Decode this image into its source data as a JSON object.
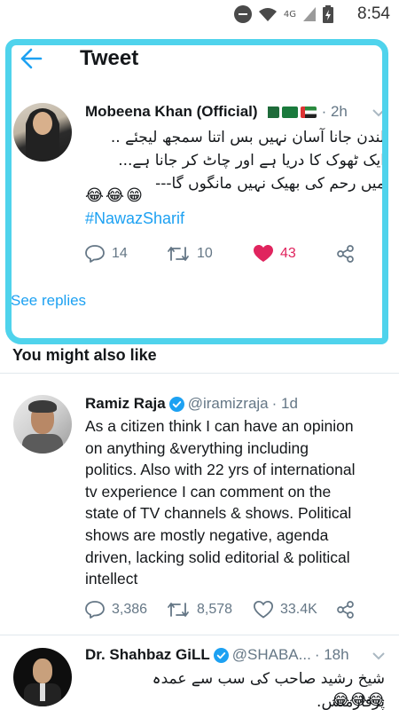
{
  "status_bar": {
    "network_label": "4G",
    "time": "8:54"
  },
  "header": {
    "title": "Tweet"
  },
  "main_tweet": {
    "name": "Mobeena Khan (Official)",
    "time": "· 2h",
    "lines": [
      "لندن جانا آسان نہیں بس اتنا سمجھ لیجئے ..",
      "ایک ٹھوک کا دریا ہے اور چاٹ کر جانا ہے...",
      "میں رحم کی بھیک نہیں مانگوں گا---"
    ],
    "emojis": "😂😂😁",
    "hashtag": "#NawazSharif",
    "replies": "14",
    "retweets": "10",
    "likes": "43"
  },
  "see_replies": "See replies",
  "section_title": "You might also like",
  "tweets": [
    {
      "name": "Ramiz Raja",
      "handle": "@iramizraja",
      "time": "· 1d",
      "lines": [
        "As a citizen think I can have an opinion",
        "on anything &verything including",
        "politics. Also with 22 yrs of international",
        "tv experience I can comment on the",
        "state of TV channels & shows. Political",
        "shows are mostly negative, agenda",
        "driven, lacking solid editorial & political",
        "intellect"
      ],
      "replies": "3,386",
      "retweets": "8,578",
      "likes": "33.4K"
    },
    {
      "name": "Dr. Shahbaz GiLL",
      "handle": "@SHABA...",
      "time": "· 18h",
      "text": "شیخ رشید صاحب کی سب سے عمدہ پرفارمنس.",
      "emojis": "😂😂😂"
    }
  ],
  "colors": {
    "accent": "#1da1f2",
    "like": "#e0245e",
    "muted": "#657786",
    "highlight": "#4fd3ec"
  },
  "icons": [
    "back-arrow-icon",
    "chevron-down-icon",
    "reply-icon",
    "retweet-icon",
    "heart-icon",
    "share-icon",
    "verified-icon"
  ]
}
